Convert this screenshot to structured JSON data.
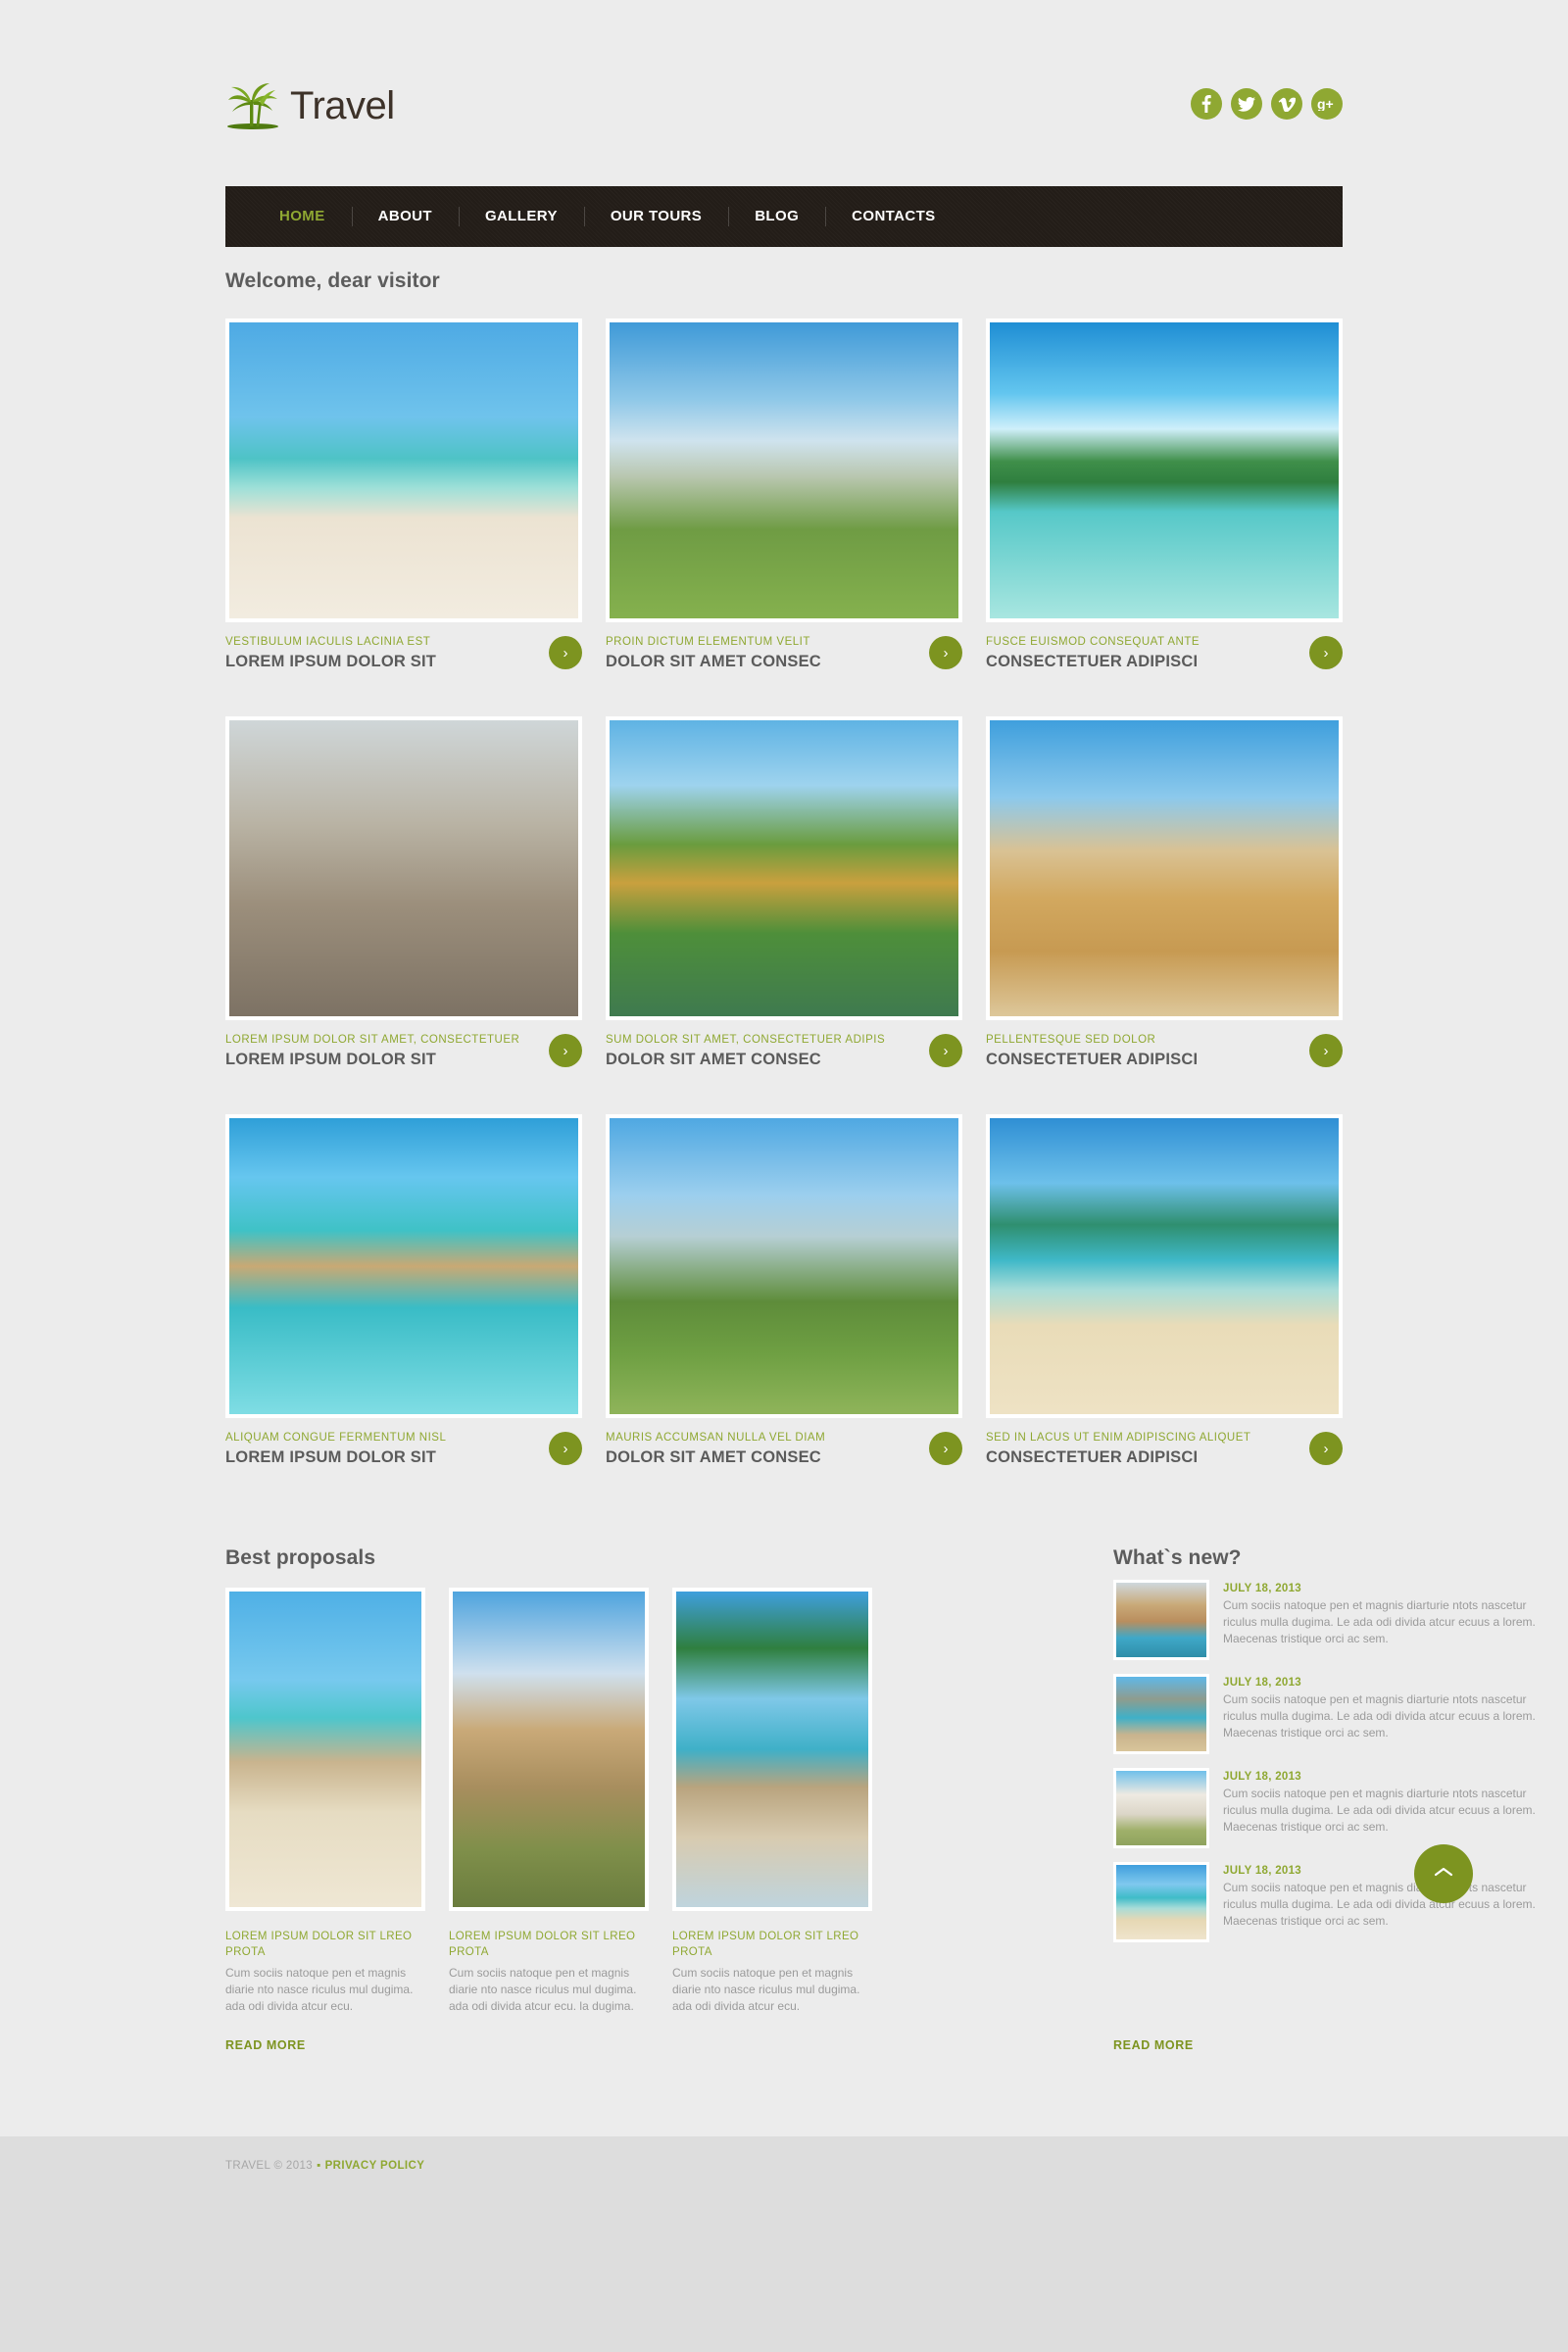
{
  "site": {
    "logo_text": "Travel",
    "logo_icon": "palm-tree-icon"
  },
  "social": [
    {
      "name": "facebook-icon",
      "label": "f"
    },
    {
      "name": "twitter-icon",
      "label": "t"
    },
    {
      "name": "vimeo-icon",
      "label": "v"
    },
    {
      "name": "google-plus-icon",
      "label": "g+"
    }
  ],
  "nav": {
    "items": [
      {
        "label": "HOME",
        "active": true
      },
      {
        "label": "ABOUT",
        "active": false
      },
      {
        "label": "GALLERY",
        "active": false
      },
      {
        "label": "OUR TOURS",
        "active": false
      },
      {
        "label": "BLOG",
        "active": false
      },
      {
        "label": "CONTACTS",
        "active": false
      }
    ]
  },
  "welcome": {
    "title": "Welcome, dear visitor"
  },
  "gallery": {
    "arrow_glyph": "›",
    "items": [
      {
        "subtitle": "VESTIBULUM IACULIS LACINIA EST",
        "title": "LOREM IPSUM DOLOR SIT",
        "image": "beach-umbrellas-photo"
      },
      {
        "subtitle": "PROIN DICTUM ELEMENTUM VELIT",
        "title": "DOLOR SIT AMET CONSEC",
        "image": "french-chateau-photo"
      },
      {
        "subtitle": "FUSCE EUISMOD CONSEQUAT ANTE",
        "title": "CONSECTETUER ADIPISCI",
        "image": "tropical-lagoon-photo"
      },
      {
        "subtitle": "LOREM IPSUM DOLOR SIT AMET, CONSECTETUER",
        "title": "LOREM IPSUM DOLOR SIT",
        "image": "westminster-palace-photo"
      },
      {
        "subtitle": "SUM DOLOR SIT AMET, CONSECTETUER ADIPIS",
        "title": "DOLOR SIT AMET CONSEC",
        "image": "thai-temple-photo"
      },
      {
        "subtitle": "PELLENTESQUE SED DOLOR",
        "title": "CONSECTETUER ADIPISCI",
        "image": "egypt-pyramid-photo"
      },
      {
        "subtitle": "ALIQUAM CONGUE FERMENTUM NISL",
        "title": "LOREM IPSUM DOLOR SIT",
        "image": "overwater-bungalow-photo"
      },
      {
        "subtitle": "MAURIS ACCUMSAN NULLA VEL DIAM",
        "title": "DOLOR SIT AMET CONSEC",
        "image": "eiffel-tower-photo"
      },
      {
        "subtitle": "SED IN LACUS UT ENIM ADIPISCING ALIQUET",
        "title": "CONSECTETUER ADIPISCI",
        "image": "caribbean-beach-photo"
      }
    ]
  },
  "proposals": {
    "title": "Best proposals",
    "read_more": "READ MORE",
    "items": [
      {
        "title": "LOREM IPSUM DOLOR SIT LREO PROTA",
        "text": "Cum sociis natoque pen et magnis diarie nto nasce riculus mul dugima. ada odi divida atcur ecu.",
        "image": "couple-on-beach-photo"
      },
      {
        "title": "LOREM IPSUM DOLOR SIT LREO PROTA",
        "text": "Cum sociis natoque pen et magnis diarie nto nasce riculus mul dugima. ada odi divida atcur ecu. la dugima.",
        "image": "ancient-ruins-photo"
      },
      {
        "title": "LOREM IPSUM DOLOR SIT LREO PROTA",
        "text": "Cum sociis natoque pen et magnis diarie nto nasce riculus mul dugima. ada odi divida atcur ecu.",
        "image": "longtail-boat-photo"
      }
    ]
  },
  "news": {
    "title": "What`s new?",
    "read_more": "READ MORE",
    "items": [
      {
        "date": "JULY 18, 2013",
        "text": "Cum sociis natoque pen et magnis diarturie ntots nascetur riculus mulla dugima. Le ada odi divida atcur ecuus a lorem. Maecenas tristique orci ac sem.",
        "image": "venice-canal-photo"
      },
      {
        "date": "JULY 18, 2013",
        "text": "Cum sociis natoque pen et magnis diarturie ntots nascetur riculus mulla dugima. Le ada odi divida atcur ecuus a lorem. Maecenas tristique orci ac sem.",
        "image": "rocky-cove-photo"
      },
      {
        "date": "JULY 18, 2013",
        "text": "Cum sociis natoque pen et magnis diarturie ntots nascetur riculus mulla dugima. Le ada odi divida atcur ecuus a lorem. Maecenas tristique orci ac sem.",
        "image": "white-villa-photo"
      },
      {
        "date": "JULY 18, 2013",
        "text": "Cum sociis natoque pen et magnis diarturie ntots nascetur riculus mulla dugima. Le ada odi divida atcur ecuus a lorem. Maecenas tristique orci ac sem.",
        "image": "sunny-beach-photo"
      }
    ]
  },
  "back_to_top": {
    "name": "back-to-top-button",
    "icon": "chevron-up-icon"
  },
  "footer": {
    "copyright": "TRAVEL © 2013",
    "separator": "▪",
    "privacy": "PRIVACY POLICY"
  },
  "colors": {
    "accent_green": "#8fa832",
    "accent_green_dark": "#7d9420",
    "nav_bg": "#231d18",
    "page_bg": "#ececec",
    "footer_bg": "#dddddd",
    "heading_gray": "#5c5c5c",
    "body_gray": "#9b9b9b"
  }
}
